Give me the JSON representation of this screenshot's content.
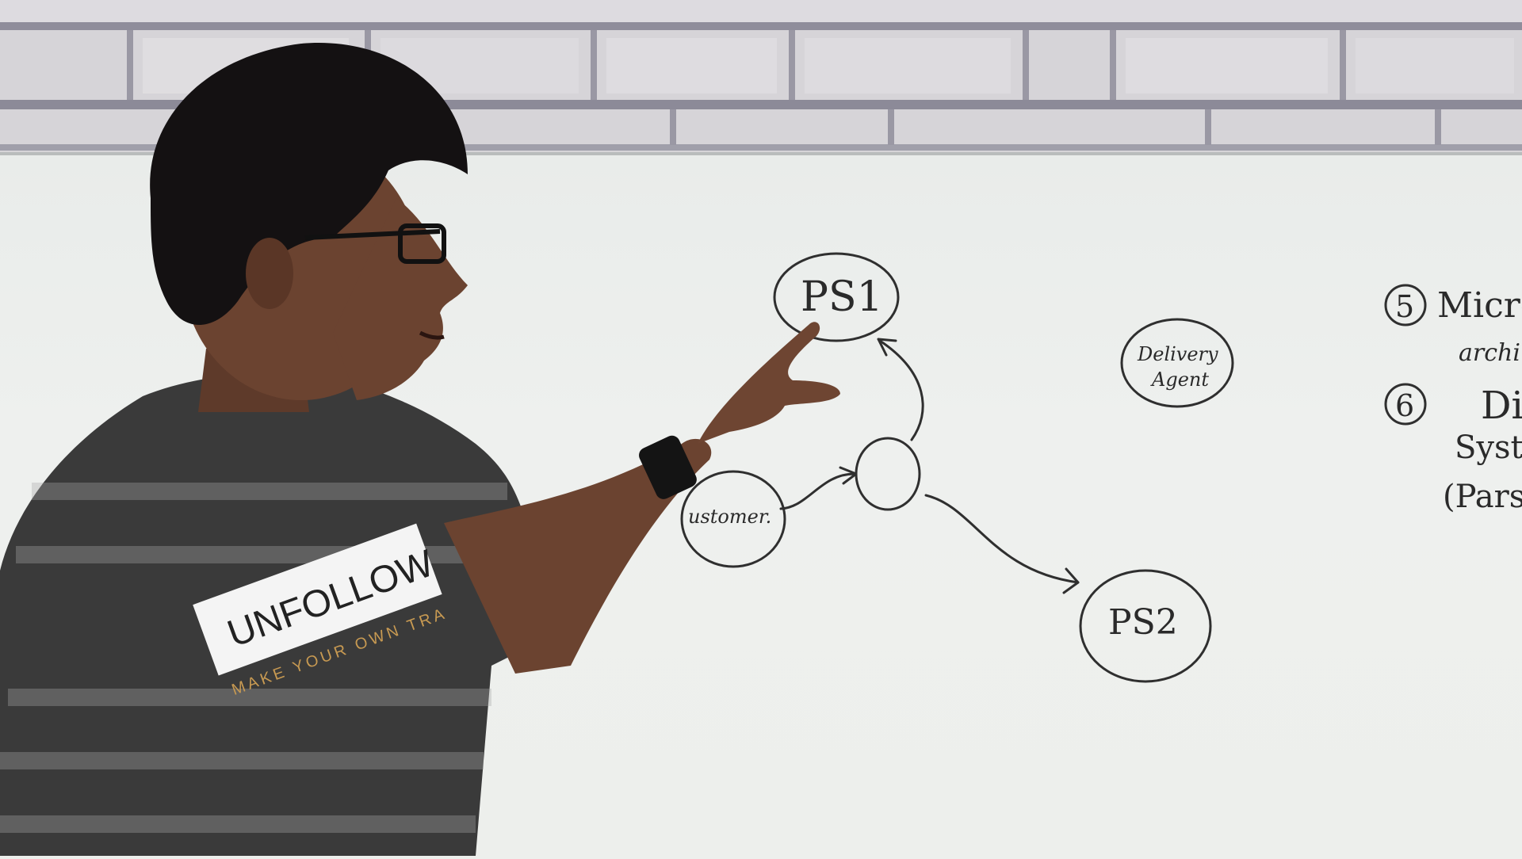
{
  "board": {
    "node_ps1": "PS1",
    "node_ps2": "PS2",
    "node_customer": "ustomer.",
    "node_delivery_line1": "Delivery",
    "node_delivery_line2": "Agent",
    "list_item5_num": "5",
    "list_item5_text": "Micro",
    "list_item5_sub": "archi",
    "list_item6_num": "6",
    "list_item6_text": "Dista",
    "list_item6_sub1": "Syste",
    "list_item6_sub2": "(Pars"
  },
  "shirt": {
    "logo_text": "UNFOLLOW",
    "tagline": "MAKE YOUR OWN TRA"
  },
  "colors": {
    "board": "#eef0ee",
    "marker": "#2f2f2f",
    "brick": "#d8d6da",
    "mortar": "#8a8996",
    "shirt_dark": "#3c3c3c",
    "shirt_stripe": "#8a8a8a",
    "skin": "#6b4330",
    "hair": "#141112"
  }
}
